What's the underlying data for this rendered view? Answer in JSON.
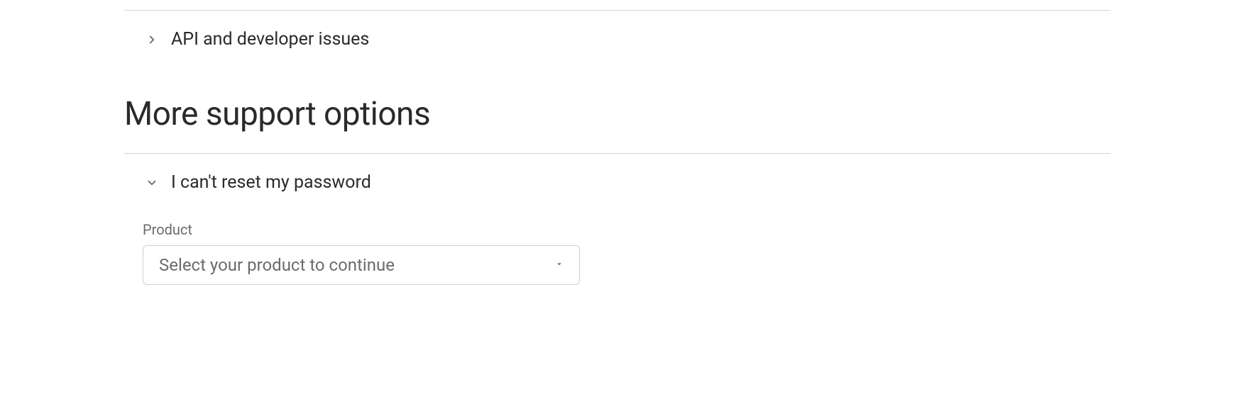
{
  "topAccordion": {
    "label": "API and developer issues"
  },
  "sectionHeading": "More support options",
  "expandedAccordion": {
    "label": "I can't reset my password"
  },
  "form": {
    "fieldLabel": "Product",
    "selectPlaceholder": "Select your product to continue"
  }
}
